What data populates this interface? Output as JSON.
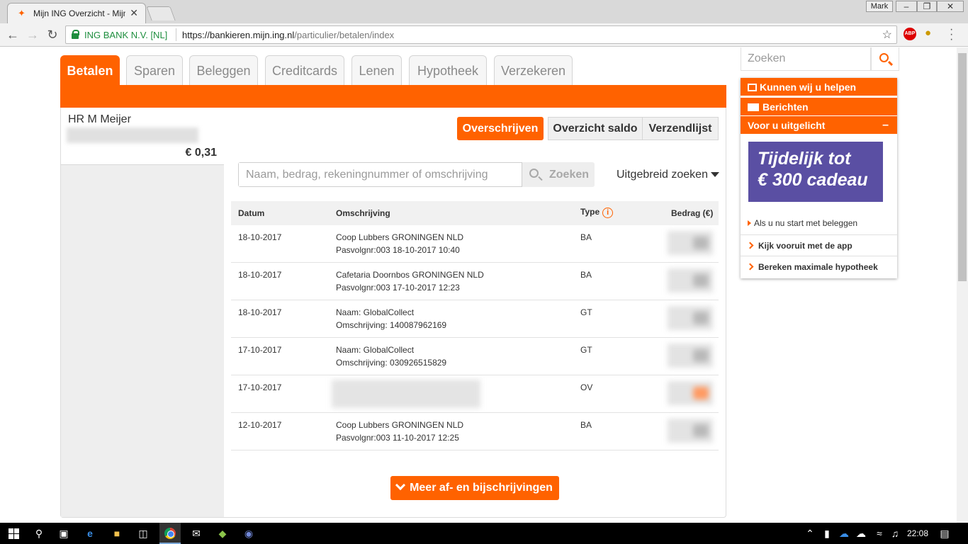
{
  "browser": {
    "tab_title": "Mijn ING Overzicht - Mijn",
    "profile_name": "Mark",
    "secure_label": "ING BANK N.V. [NL]",
    "url_host": "https://bankieren.mijn.ing.nl",
    "url_path": "/particulier/betalen/index"
  },
  "nav_tabs": [
    "Betalen",
    "Sparen",
    "Beleggen",
    "Creditcards",
    "Lenen",
    "Hypotheek",
    "Verzekeren"
  ],
  "account": {
    "name": "HR M Meijer",
    "balance": "€ 0,31"
  },
  "actions": {
    "transfer": "Overschrijven",
    "balance_overview": "Overzicht saldo",
    "send_list": "Verzendlijst"
  },
  "search": {
    "placeholder": "Naam, bedrag, rekeningnummer of omschrijving",
    "button": "Zoeken",
    "advanced": "Uitgebreid zoeken"
  },
  "table": {
    "headers": {
      "date": "Datum",
      "description": "Omschrijving",
      "type": "Type",
      "amount": "Bedrag (€)"
    },
    "rows": [
      {
        "date": "18-10-2017",
        "desc1": "Coop Lubbers GRONINGEN NLD",
        "desc2": "Pasvolgnr:003 18-10-2017 10:40",
        "type": "BA"
      },
      {
        "date": "18-10-2017",
        "desc1": "Cafetaria Doornbos GRONINGEN NLD",
        "desc2": "Pasvolgnr:003 17-10-2017 12:23",
        "type": "BA"
      },
      {
        "date": "18-10-2017",
        "desc1": "Naam: GlobalCollect",
        "desc2": "Omschrijving: 140087962169",
        "type": "GT"
      },
      {
        "date": "17-10-2017",
        "desc1": "Naam: GlobalCollect",
        "desc2": "Omschrijving: 030926515829",
        "type": "GT"
      },
      {
        "date": "17-10-2017",
        "desc1": "",
        "desc2": "",
        "type": "OV"
      },
      {
        "date": "12-10-2017",
        "desc1": "Coop Lubbers GRONINGEN NLD",
        "desc2": "Pasvolgnr:003 11-10-2017 12:25",
        "type": "BA"
      }
    ],
    "more_button": "Meer af- en bijschrijvingen"
  },
  "sidebar": {
    "search_placeholder": "Zoeken",
    "help": "Kunnen wij u helpen",
    "messages": "Berichten",
    "highlight": "Voor u uitgelicht",
    "promo_line1": "Tijdelijk tot",
    "promo_line2": "€ 300 cadeau",
    "promo_link": "Als u nu start met beleggen",
    "link_app": "Kijk vooruit met de app",
    "link_mortgage": "Bereken maximale hypotheek"
  },
  "taskbar": {
    "time": "22:08"
  },
  "colors": {
    "brand_orange": "#ff6200",
    "promo_purple": "#5a4fa3"
  }
}
